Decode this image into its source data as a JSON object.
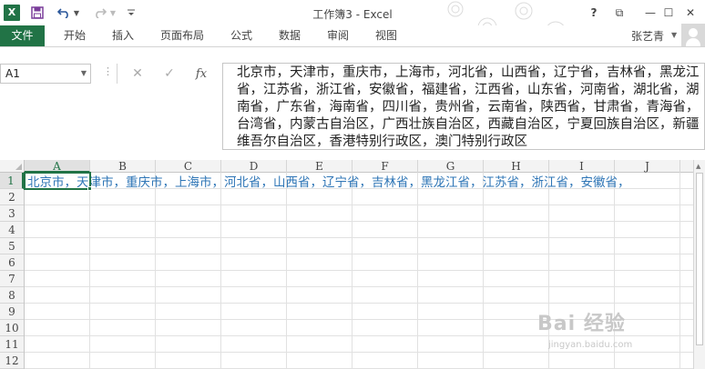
{
  "app": {
    "title": "工作簿3 - Excel",
    "logo_text": "X"
  },
  "colors": {
    "accent": "#217346",
    "cell_text": "#2e75b6"
  },
  "quick_access": {
    "icons": [
      "save-icon",
      "undo-icon",
      "redo-icon",
      "customize-icon"
    ]
  },
  "window_controls": {
    "help": "?",
    "ribbon_options": "⧉",
    "minimize": "—",
    "maximize": "☐",
    "close": "✕"
  },
  "ribbon": {
    "tabs": [
      "文件",
      "开始",
      "插入",
      "页面布局",
      "公式",
      "数据",
      "审阅",
      "视图"
    ],
    "user": "张艺青"
  },
  "formula_bar": {
    "name_box": "A1",
    "content": "北京市，天津市，重庆市，上海市，河北省，山西省，辽宁省，吉林省，黑龙江省，江苏省，浙江省，安徽省，福建省，江西省，山东省，河南省，湖北省，湖南省，广东省，海南省，四川省，贵州省，云南省，陕西省，甘肃省，青海省，台湾省，内蒙古自治区，广西壮族自治区，西藏自治区，宁夏回族自治区，新疆维吾尔自治区，香港特别行政区，澳门特别行政区",
    "fx": "fx"
  },
  "sheet": {
    "columns": [
      "A",
      "B",
      "C",
      "D",
      "E",
      "F",
      "G",
      "H",
      "I",
      "J"
    ],
    "rows": [
      "1",
      "2",
      "3",
      "4",
      "5",
      "6",
      "7",
      "8",
      "9",
      "10",
      "11",
      "12"
    ],
    "active_cell": "A1",
    "a1_display": "北京市，天津市，重庆市，上海市，河北省，山西省，辽宁省，吉林省，黑龙江省，江苏省，浙江省，安徽省，"
  },
  "watermark": {
    "main": "Bai 经验",
    "sub": "jingyan.baidu.com"
  }
}
